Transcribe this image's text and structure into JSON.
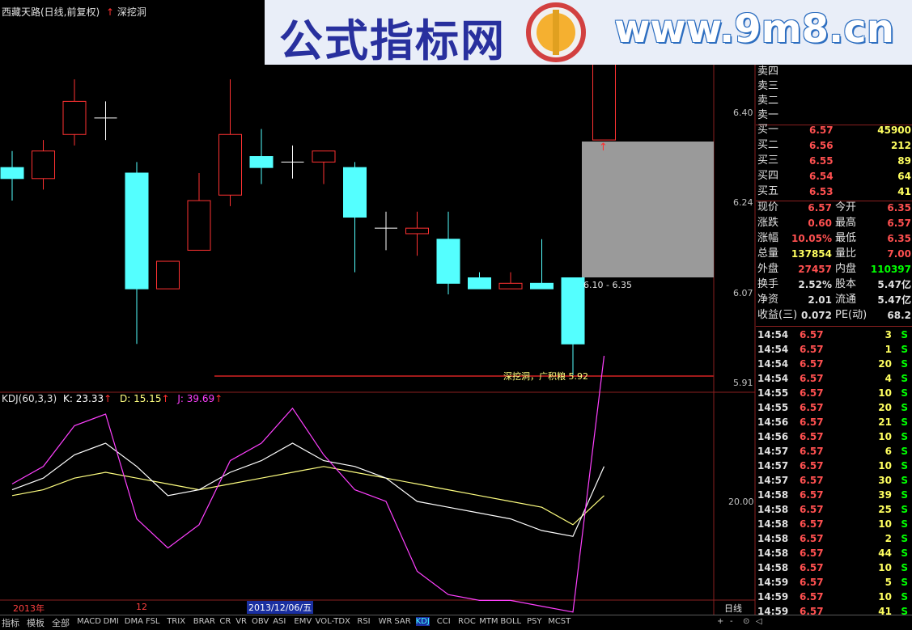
{
  "header": {
    "stock_title": "西藏天路(日线,前复权)",
    "indicator_name": "深挖洞",
    "arrow": "↑"
  },
  "watermark": {
    "text_cn": "公式指标网",
    "text_url": "www.9m8.cn",
    "logo_text": "9m8"
  },
  "price_axis": {
    "ticks": [
      "6.40",
      "6.24",
      "6.07",
      "5.91"
    ]
  },
  "candles": [
    {
      "o": 6.28,
      "h": 6.33,
      "l": 6.24,
      "c": 6.3,
      "color": "cyan"
    },
    {
      "o": 6.28,
      "h": 6.35,
      "l": 6.26,
      "c": 6.33,
      "color": "red"
    },
    {
      "o": 6.36,
      "h": 6.46,
      "l": 6.34,
      "c": 6.42,
      "color": "red"
    },
    {
      "o": 6.39,
      "h": 6.42,
      "l": 6.35,
      "c": 6.39,
      "color": "white"
    },
    {
      "o": 6.29,
      "h": 6.31,
      "l": 5.98,
      "c": 6.08,
      "color": "cyan"
    },
    {
      "o": 6.08,
      "h": 6.13,
      "l": 6.08,
      "c": 6.13,
      "color": "red"
    },
    {
      "o": 6.15,
      "h": 6.29,
      "l": 6.15,
      "c": 6.24,
      "color": "red"
    },
    {
      "o": 6.25,
      "h": 6.46,
      "l": 6.23,
      "c": 6.36,
      "color": "red"
    },
    {
      "o": 6.32,
      "h": 6.37,
      "l": 6.27,
      "c": 6.3,
      "color": "cyan"
    },
    {
      "o": 6.31,
      "h": 6.34,
      "l": 6.28,
      "c": 6.31,
      "color": "white"
    },
    {
      "o": 6.31,
      "h": 6.33,
      "l": 6.27,
      "c": 6.33,
      "color": "red"
    },
    {
      "o": 6.3,
      "h": 6.31,
      "l": 6.11,
      "c": 6.21,
      "color": "cyan"
    },
    {
      "o": 6.19,
      "h": 6.22,
      "l": 6.15,
      "c": 6.19,
      "color": "white"
    },
    {
      "o": 6.18,
      "h": 6.22,
      "l": 6.14,
      "c": 6.19,
      "color": "red"
    },
    {
      "o": 6.17,
      "h": 6.22,
      "l": 6.07,
      "c": 6.09,
      "color": "cyan"
    },
    {
      "o": 6.1,
      "h": 6.11,
      "l": 6.08,
      "c": 6.08,
      "color": "cyan"
    },
    {
      "o": 6.08,
      "h": 6.11,
      "l": 6.08,
      "c": 6.09,
      "color": "red"
    },
    {
      "o": 6.09,
      "h": 6.17,
      "l": 6.08,
      "c": 6.08,
      "color": "cyan"
    },
    {
      "o": 6.1,
      "h": 6.1,
      "l": 5.92,
      "c": 5.98,
      "color": "cyan"
    },
    {
      "o": 6.35,
      "h": 6.57,
      "l": 6.35,
      "c": 6.57,
      "color": "red"
    }
  ],
  "annotations": {
    "range_box_label": "6.10 - 6.35",
    "support_label": "深挖洞，广积粮",
    "support_value": "5.92"
  },
  "kdj": {
    "label": "KDJ(60,3,3)",
    "k_label": "K: 23.33",
    "d_label": "D: 15.15",
    "j_label": "J: 39.69",
    "arrow": "↑",
    "axis_tick": "20.00",
    "k": [
      22,
      24,
      28,
      30,
      26,
      21,
      22,
      25,
      27,
      30,
      27,
      26,
      24,
      20,
      19,
      18,
      17,
      15,
      14,
      26
    ],
    "d": [
      21,
      22,
      24,
      25,
      24,
      23,
      22,
      23,
      24,
      25,
      26,
      25,
      24,
      23,
      22,
      21,
      20,
      19,
      16,
      21
    ],
    "j": [
      23,
      26,
      33,
      35,
      17,
      12,
      16,
      27,
      30,
      36,
      28,
      22,
      20,
      8,
      4,
      3,
      3,
      2,
      1,
      45
    ]
  },
  "time_axis": {
    "year_label": "2013年",
    "month_label": "12",
    "date_label": "2013/12/06/五",
    "period_label": "日线"
  },
  "order_book": {
    "sells": [
      {
        "label": "卖四",
        "price": "",
        "vol": ""
      },
      {
        "label": "卖三",
        "price": "",
        "vol": ""
      },
      {
        "label": "卖二",
        "price": "",
        "vol": ""
      },
      {
        "label": "卖一",
        "price": "",
        "vol": ""
      }
    ],
    "buys": [
      {
        "label": "买一",
        "price": "6.57",
        "vol": "45900"
      },
      {
        "label": "买二",
        "price": "6.56",
        "vol": "212"
      },
      {
        "label": "买三",
        "price": "6.55",
        "vol": "89"
      },
      {
        "label": "买四",
        "price": "6.54",
        "vol": "64"
      },
      {
        "label": "买五",
        "price": "6.53",
        "vol": "41"
      }
    ]
  },
  "quote": [
    {
      "l1": "现价",
      "v1": "6.57",
      "c1": "#ff5050",
      "l2": "今开",
      "v2": "6.35",
      "c2": "#ff5050"
    },
    {
      "l1": "涨跌",
      "v1": "0.60",
      "c1": "#ff5050",
      "l2": "最高",
      "v2": "6.57",
      "c2": "#ff5050"
    },
    {
      "l1": "涨幅",
      "v1": "10.05%",
      "c1": "#ff5050",
      "l2": "最低",
      "v2": "6.35",
      "c2": "#ff5050"
    },
    {
      "l1": "总量",
      "v1": "137854",
      "c1": "#ffff60",
      "l2": "量比",
      "v2": "7.00",
      "c2": "#ff5050"
    },
    {
      "l1": "外盘",
      "v1": "27457",
      "c1": "#ff5050",
      "l2": "内盘",
      "v2": "110397",
      "c2": "#00ff00"
    },
    {
      "l1": "换手",
      "v1": "2.52%",
      "c1": "#e0e0e0",
      "l2": "股本",
      "v2": "5.47亿",
      "c2": "#e0e0e0"
    },
    {
      "l1": "净资",
      "v1": "2.01",
      "c1": "#e0e0e0",
      "l2": "流通",
      "v2": "5.47亿",
      "c2": "#e0e0e0"
    },
    {
      "l1": "收益(三)",
      "v1": "0.072",
      "c1": "#e0e0e0",
      "l2": "PE(动)",
      "v2": "68.2",
      "c2": "#e0e0e0"
    }
  ],
  "ticks": [
    {
      "t": "14:54",
      "p": "6.57",
      "v": "3",
      "s": "S"
    },
    {
      "t": "14:54",
      "p": "6.57",
      "v": "1",
      "s": "S"
    },
    {
      "t": "14:54",
      "p": "6.57",
      "v": "20",
      "s": "S"
    },
    {
      "t": "14:54",
      "p": "6.57",
      "v": "4",
      "s": "S"
    },
    {
      "t": "14:55",
      "p": "6.57",
      "v": "10",
      "s": "S"
    },
    {
      "t": "14:55",
      "p": "6.57",
      "v": "20",
      "s": "S"
    },
    {
      "t": "14:56",
      "p": "6.57",
      "v": "21",
      "s": "S"
    },
    {
      "t": "14:56",
      "p": "6.57",
      "v": "10",
      "s": "S"
    },
    {
      "t": "14:57",
      "p": "6.57",
      "v": "6",
      "s": "S"
    },
    {
      "t": "14:57",
      "p": "6.57",
      "v": "10",
      "s": "S"
    },
    {
      "t": "14:57",
      "p": "6.57",
      "v": "30",
      "s": "S"
    },
    {
      "t": "14:58",
      "p": "6.57",
      "v": "39",
      "s": "S"
    },
    {
      "t": "14:58",
      "p": "6.57",
      "v": "25",
      "s": "S"
    },
    {
      "t": "14:58",
      "p": "6.57",
      "v": "10",
      "s": "S"
    },
    {
      "t": "14:58",
      "p": "6.57",
      "v": "2",
      "s": "S"
    },
    {
      "t": "14:58",
      "p": "6.57",
      "v": "44",
      "s": "S"
    },
    {
      "t": "14:58",
      "p": "6.57",
      "v": "10",
      "s": "S"
    },
    {
      "t": "14:59",
      "p": "6.57",
      "v": "5",
      "s": "S"
    },
    {
      "t": "14:59",
      "p": "6.57",
      "v": "10",
      "s": "S"
    },
    {
      "t": "14:59",
      "p": "6.57",
      "v": "41",
      "s": "S"
    }
  ],
  "bottom_tabs": [
    "指标",
    "模板",
    "全部",
    "MACD",
    "DMI",
    "DMA",
    "FSL",
    "TRIX",
    "BRAR",
    "CR",
    "VR",
    "OBV",
    "ASI",
    "EMV",
    "VOL-TDX",
    "RSI",
    "WR",
    "SAR",
    "KDJ",
    "CCI",
    "ROC",
    "MTM",
    "BOLL",
    "PSY",
    "MCST"
  ],
  "active_tab": "KDJ",
  "bottom_controls": [
    "+",
    "-",
    "⊙",
    "◁"
  ]
}
